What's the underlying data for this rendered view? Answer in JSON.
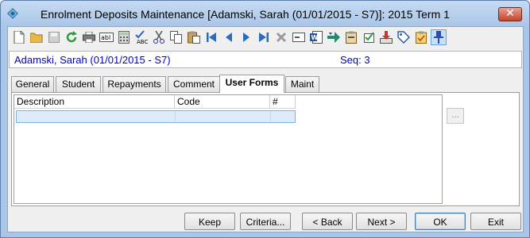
{
  "window": {
    "title": "Enrolment Deposits Maintenance  [Adamski, Sarah (01/01/2015 - S7)]:  2015 Term 1",
    "close_label": "✕"
  },
  "toolbar": {
    "buttons": [
      {
        "name": "new-icon"
      },
      {
        "name": "open-icon"
      },
      {
        "name": "save-icon"
      },
      {
        "name": "refresh-icon"
      },
      {
        "name": "print-icon"
      },
      {
        "name": "field-icon"
      },
      {
        "name": "calculator-icon"
      },
      {
        "name": "spellcheck-icon"
      },
      {
        "name": "cut-icon"
      },
      {
        "name": "copy-icon"
      },
      {
        "name": "paste-icon"
      },
      {
        "name": "first-record-icon"
      },
      {
        "name": "previous-record-icon"
      },
      {
        "name": "next-record-icon"
      },
      {
        "name": "last-record-icon"
      },
      {
        "name": "delete-icon"
      },
      {
        "name": "email-icon"
      },
      {
        "name": "word-icon"
      },
      {
        "name": "filter-icon"
      },
      {
        "name": "clipboard-icon"
      },
      {
        "name": "check-icon"
      },
      {
        "name": "download-icon"
      },
      {
        "name": "tag-icon"
      },
      {
        "name": "task-icon"
      },
      {
        "name": "pin-icon"
      }
    ]
  },
  "info": {
    "student": "Adamski, Sarah (01/01/2015 - S7)",
    "seq": "Seq: 3"
  },
  "tabs": [
    {
      "label": "General"
    },
    {
      "label": "Student"
    },
    {
      "label": "Repayments"
    },
    {
      "label": "Comment"
    },
    {
      "label": "User Forms",
      "active": true
    },
    {
      "label": "Maint"
    }
  ],
  "grid": {
    "columns": [
      "Description",
      "Code",
      "#"
    ],
    "rows": [
      [
        "",
        "",
        ""
      ]
    ]
  },
  "ellipsis_label": "...",
  "buttons": {
    "keep": "Keep",
    "criteria": "Criteria...",
    "back": "< Back",
    "next": "Next >",
    "ok": "OK",
    "exit": "Exit"
  },
  "colors": {
    "info_text": "#0000c8",
    "row_selected": "#dcebfb",
    "title_bar": "#a9c6e8"
  }
}
